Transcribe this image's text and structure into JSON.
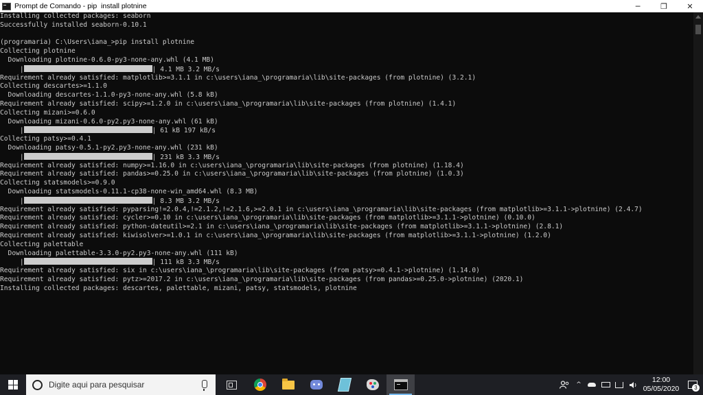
{
  "window": {
    "title": "Prompt de Comando - pip  install plotnine",
    "minimize": "─",
    "maximize": "❐",
    "close": "✕"
  },
  "console": {
    "lines": [
      {
        "text": "Installing collected packages: seaborn"
      },
      {
        "text": "Successfully installed seaborn-0.10.1"
      },
      {
        "text": ""
      },
      {
        "text": "(programaria) C:\\Users\\iana_>pip install plotnine"
      },
      {
        "text": "Collecting plotnine"
      },
      {
        "text": "  Downloading plotnine-0.6.0-py3-none-any.whl (4.1 MB)"
      },
      {
        "progress": true,
        "prefix": "     |",
        "suffix": "| 4.1 MB 3.2 MB/s"
      },
      {
        "text": "Requirement already satisfied: matplotlib>=3.1.1 in c:\\users\\iana_\\programaria\\lib\\site-packages (from plotnine) (3.2.1)"
      },
      {
        "text": "Collecting descartes>=1.1.0"
      },
      {
        "text": "  Downloading descartes-1.1.0-py3-none-any.whl (5.8 kB)"
      },
      {
        "text": "Requirement already satisfied: scipy>=1.2.0 in c:\\users\\iana_\\programaria\\lib\\site-packages (from plotnine) (1.4.1)"
      },
      {
        "text": "Collecting mizani>=0.6.0"
      },
      {
        "text": "  Downloading mizani-0.6.0-py2.py3-none-any.whl (61 kB)"
      },
      {
        "progress": true,
        "prefix": "     |",
        "suffix": "| 61 kB 197 kB/s"
      },
      {
        "text": "Collecting patsy>=0.4.1"
      },
      {
        "text": "  Downloading patsy-0.5.1-py2.py3-none-any.whl (231 kB)"
      },
      {
        "progress": true,
        "prefix": "     |",
        "suffix": "| 231 kB 3.3 MB/s"
      },
      {
        "text": "Requirement already satisfied: numpy>=1.16.0 in c:\\users\\iana_\\programaria\\lib\\site-packages (from plotnine) (1.18.4)"
      },
      {
        "text": "Requirement already satisfied: pandas>=0.25.0 in c:\\users\\iana_\\programaria\\lib\\site-packages (from plotnine) (1.0.3)"
      },
      {
        "text": "Collecting statsmodels>=0.9.0"
      },
      {
        "text": "  Downloading statsmodels-0.11.1-cp38-none-win_amd64.whl (8.3 MB)"
      },
      {
        "progress": true,
        "prefix": "     |",
        "suffix": "| 8.3 MB 3.2 MB/s"
      },
      {
        "text": "Requirement already satisfied: pyparsing!=2.0.4,!=2.1.2,!=2.1.6,>=2.0.1 in c:\\users\\iana_\\programaria\\lib\\site-packages (from matplotlib>=3.1.1->plotnine) (2.4.7)"
      },
      {
        "text": "Requirement already satisfied: cycler>=0.10 in c:\\users\\iana_\\programaria\\lib\\site-packages (from matplotlib>=3.1.1->plotnine) (0.10.0)"
      },
      {
        "text": "Requirement already satisfied: python-dateutil>=2.1 in c:\\users\\iana_\\programaria\\lib\\site-packages (from matplotlib>=3.1.1->plotnine) (2.8.1)"
      },
      {
        "text": "Requirement already satisfied: kiwisolver>=1.0.1 in c:\\users\\iana_\\programaria\\lib\\site-packages (from matplotlib>=3.1.1->plotnine) (1.2.0)"
      },
      {
        "text": "Collecting palettable"
      },
      {
        "text": "  Downloading palettable-3.3.0-py2.py3-none-any.whl (111 kB)"
      },
      {
        "progress": true,
        "prefix": "     |",
        "suffix": "| 111 kB 3.3 MB/s"
      },
      {
        "text": "Requirement already satisfied: six in c:\\users\\iana_\\programaria\\lib\\site-packages (from patsy>=0.4.1->plotnine) (1.14.0)"
      },
      {
        "text": "Requirement already satisfied: pytz>=2017.2 in c:\\users\\iana_\\programaria\\lib\\site-packages (from pandas>=0.25.0->plotnine) (2020.1)"
      },
      {
        "text": "Installing collected packages: descartes, palettable, mizani, patsy, statsmodels, plotnine"
      }
    ]
  },
  "taskbar": {
    "search_placeholder": "Digite aqui para pesquisar",
    "apps": [
      {
        "name": "task-view-icon",
        "cls": "taskview",
        "active": false
      },
      {
        "name": "chrome-icon",
        "cls": "chrome",
        "active": false
      },
      {
        "name": "file-explorer-icon",
        "cls": "folder",
        "active": false
      },
      {
        "name": "discord-icon",
        "cls": "discord",
        "active": false
      },
      {
        "name": "notebook-icon",
        "cls": "notebook",
        "active": false
      },
      {
        "name": "paint-icon",
        "cls": "paint",
        "active": false
      },
      {
        "name": "command-prompt-icon",
        "cls": "cmd",
        "active": true
      }
    ],
    "tray": {
      "chevron": "^",
      "time": "12:00",
      "date": "05/05/2020",
      "notification_count": "3"
    }
  },
  "colors": {
    "console_bg": "#0c0c0c",
    "console_fg": "#cccccc",
    "taskbar_bg": "#1e1f24",
    "active_indicator": "#76b9ed"
  }
}
